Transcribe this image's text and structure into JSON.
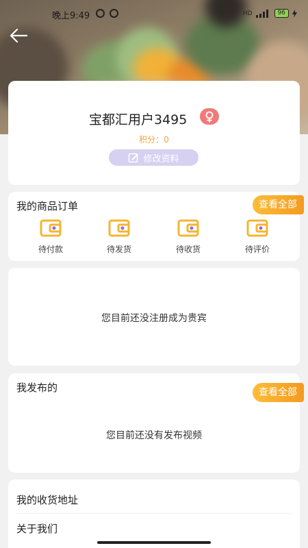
{
  "status_bar": {
    "time": "晚上9:49",
    "network": "HD",
    "battery": "96"
  },
  "header": {
    "back_icon": "arrow-left-icon"
  },
  "profile": {
    "username": "宝都汇用户3495",
    "gender_icon": "female-icon",
    "points_label": "积分：",
    "points_value": "0",
    "edit_label": "修改资料"
  },
  "orders": {
    "title": "我的商品订单",
    "view_all": "查看全部",
    "items": [
      {
        "label": "待付款",
        "icon": "wallet-icon"
      },
      {
        "label": "待发货",
        "icon": "wallet-icon"
      },
      {
        "label": "待收货",
        "icon": "wallet-icon"
      },
      {
        "label": "待评价",
        "icon": "wallet-icon"
      }
    ]
  },
  "vip": {
    "message": "您目前还没注册成为贵宾"
  },
  "posts": {
    "title": "我发布的",
    "view_all": "查看全部",
    "empty_message": "您目前还没有发布视频"
  },
  "menu": {
    "items": [
      "我的收货地址",
      "关于我们"
    ]
  },
  "colors": {
    "accent_orange": "#f59a1f",
    "points_orange": "#f2a23b",
    "edit_button_purple": "#d6d0f1",
    "gender_badge_red": "#f07a7a",
    "icon_yellow": "#f4b433",
    "icon_purple": "#8c6be0"
  }
}
